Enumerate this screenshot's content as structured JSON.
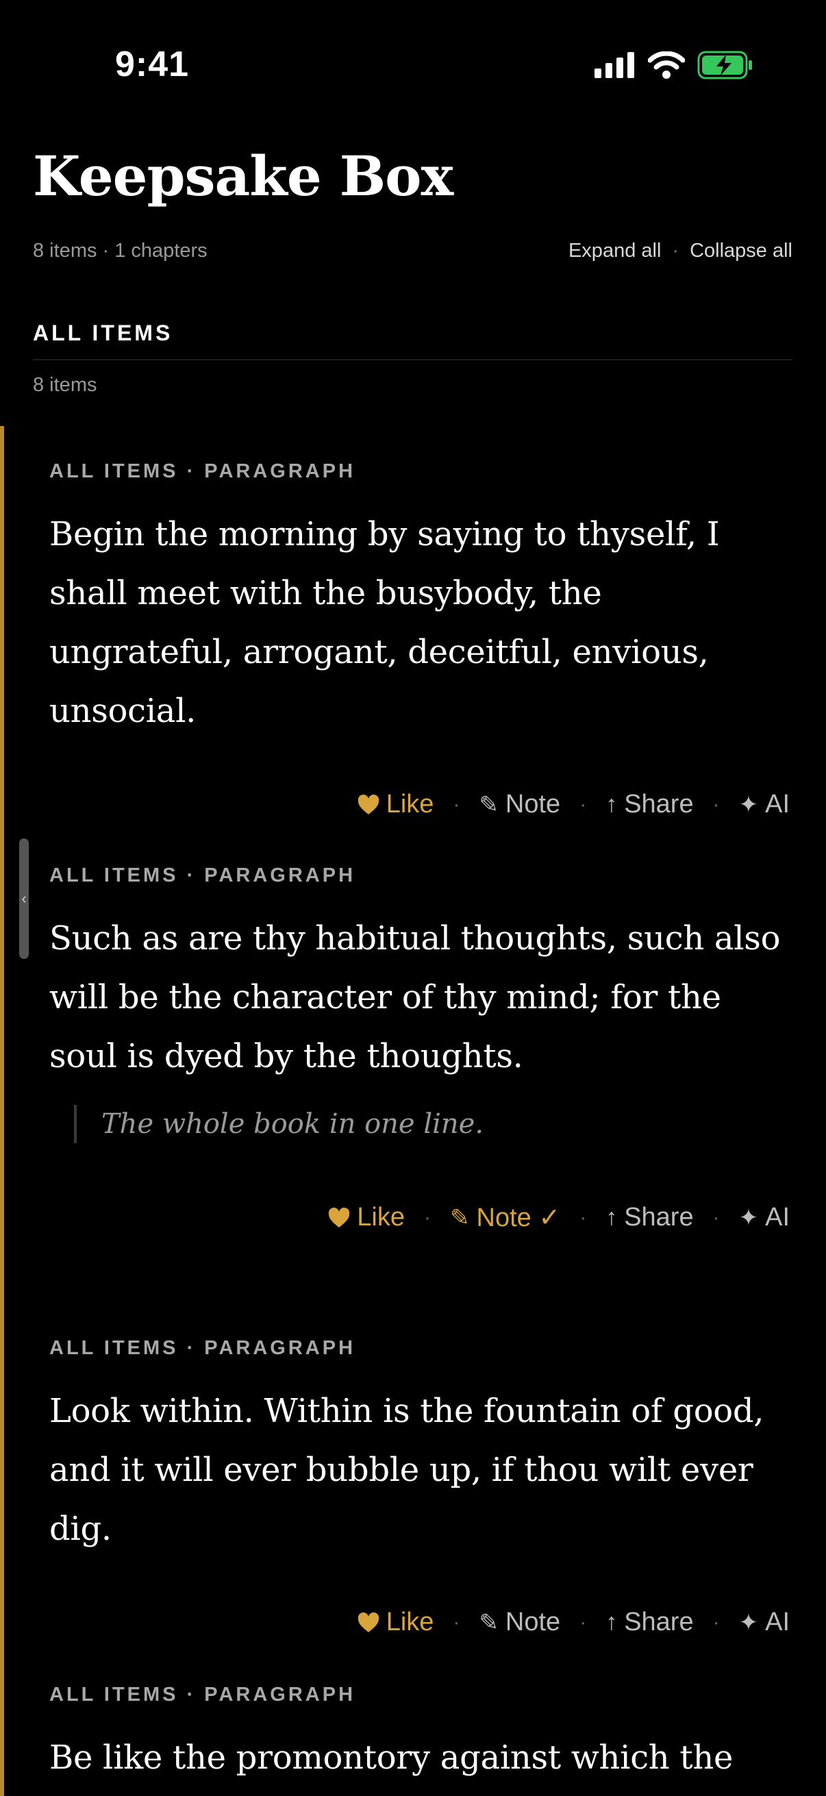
{
  "status": {
    "time": "9:41"
  },
  "header": {
    "title": "Keepsake Box",
    "meta": "8 items · 1 chapters",
    "expand_all": "Expand all",
    "separator": "·",
    "collapse_all": "Collapse all"
  },
  "section": {
    "title": "ALL ITEMS",
    "count": "8 items"
  },
  "actions": {
    "like": "Like",
    "note": "Note",
    "note_done": "Note ✓",
    "share": "Share",
    "ai": "AI"
  },
  "cards": [
    {
      "label": "ALL ITEMS · PARAGRAPH",
      "text": "Begin the morning by saying to thyself, I shall meet with the busybody, the ungrateful, arrogant, deceitful, envious, unsocial."
    },
    {
      "label": "ALL ITEMS · PARAGRAPH",
      "text": "Such as are thy habitual thoughts, such also will be the character of thy mind; for the soul is dyed by the thoughts.",
      "note": "The whole book in one line."
    },
    {
      "label": "ALL ITEMS · PARAGRAPH",
      "text": "Look within. Within is the fountain of good, and it will ever bubble up, if thou wilt ever dig."
    },
    {
      "label": "ALL ITEMS · PARAGRAPH",
      "text": "Be like the promontory against which the"
    }
  ],
  "colors": {
    "accent": "#d9a43a",
    "rail": "#b8882c",
    "battery": "#34c759"
  }
}
